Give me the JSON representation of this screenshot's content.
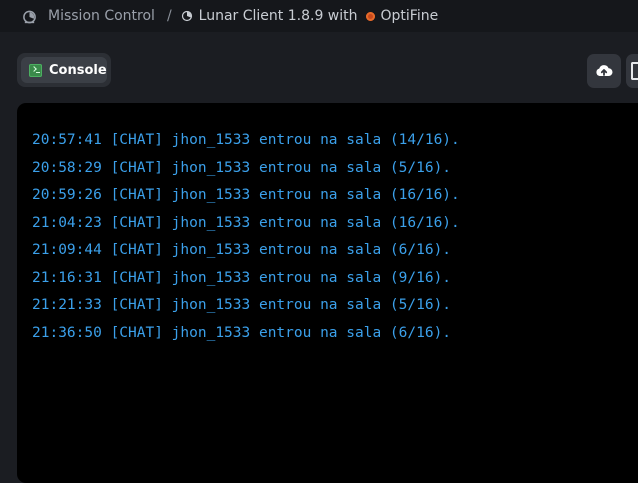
{
  "breadcrumb": {
    "root_label": "Mission Control",
    "separator": "/",
    "current_label": "Lunar Client 1.8.9 with",
    "current_suffix": "OptiFine"
  },
  "tabs": {
    "console_label": "Console"
  },
  "toolbar": {
    "upload_icon": "cloud-upload-icon"
  },
  "console": {
    "text_color": "#3ba0ea",
    "lines": [
      "20:57:41 [CHAT] jhon_1533 entrou na sala (14/16).",
      "20:58:29 [CHAT] jhon_1533 entrou na sala (5/16).",
      "20:59:26 [CHAT] jhon_1533 entrou na sala (16/16).",
      "21:04:23 [CHAT] jhon_1533 entrou na sala (16/16).",
      "21:09:44 [CHAT] jhon_1533 entrou na sala (6/16).",
      "21:16:31 [CHAT] jhon_1533 entrou na sala (9/16).",
      "21:21:33 [CHAT] jhon_1533 entrou na sala (5/16).",
      "21:36:50 [CHAT] jhon_1533 entrou na sala (6/16)."
    ]
  }
}
